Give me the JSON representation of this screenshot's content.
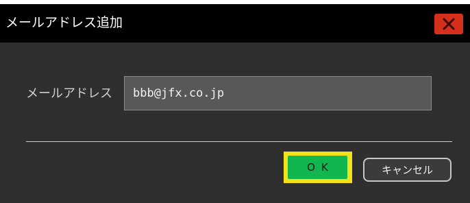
{
  "dialog": {
    "title": "メールアドレス追加",
    "close_icon": "close-x-icon"
  },
  "form": {
    "email_label": "メールアドレス",
    "email_value": "bbb@jfx.co.jp"
  },
  "buttons": {
    "ok_label": "OK",
    "cancel_label": "キャンセル"
  },
  "colors": {
    "titlebar": "#000000",
    "body": "#2f2f2f",
    "close_button": "#d4301c",
    "ok_button": "#12b64f",
    "focus_highlight": "#f2e21a"
  }
}
